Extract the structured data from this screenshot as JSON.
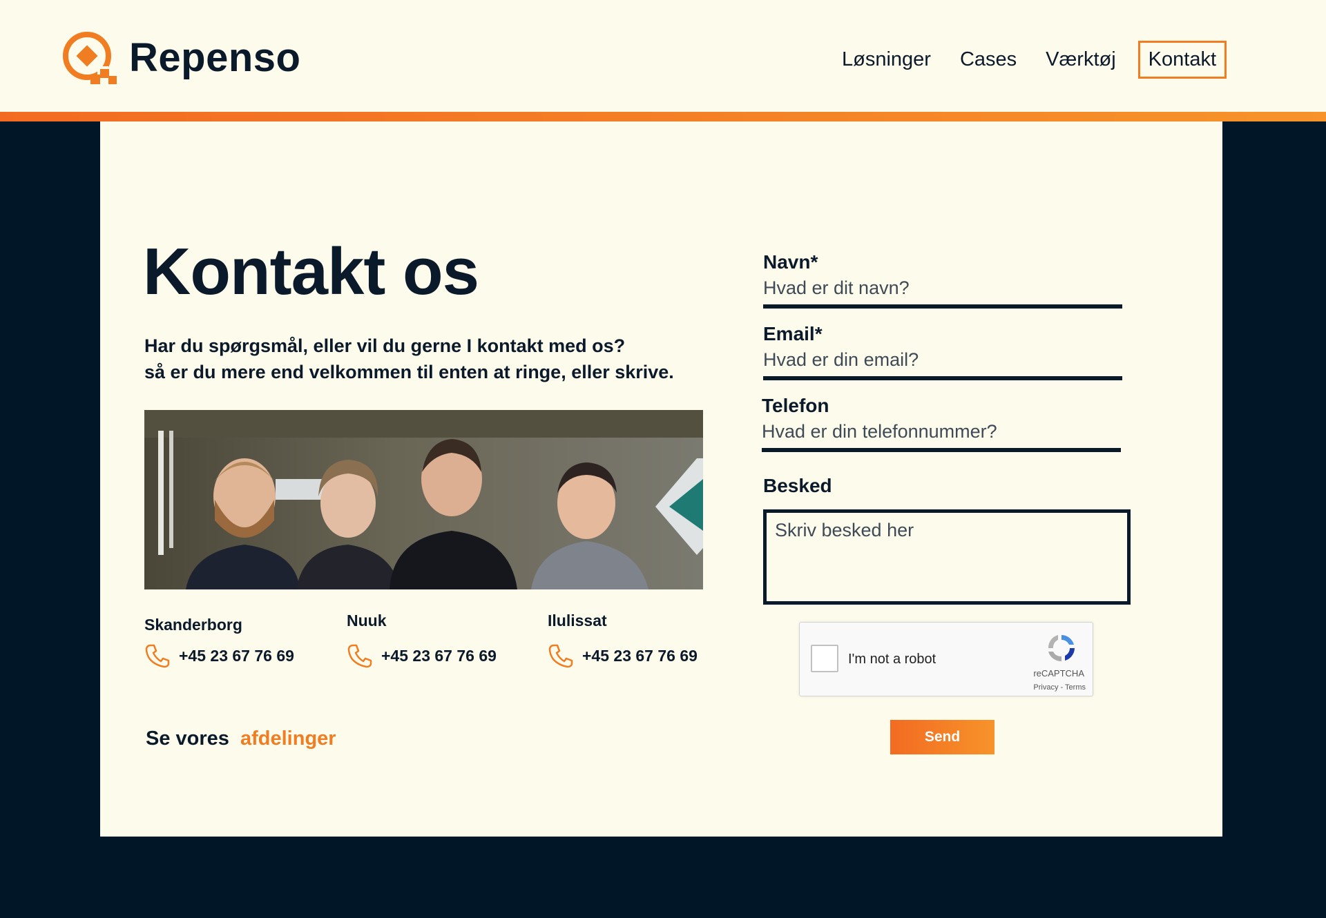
{
  "brand": {
    "name": "Repenso",
    "accent": "#f07d22",
    "dark": "#0b1a2a",
    "cream": "#fdfbeb"
  },
  "nav": {
    "items": [
      "Løsninger",
      "Cases",
      "Værktøj",
      "Kontakt"
    ],
    "active": "Kontakt"
  },
  "page": {
    "title": "Kontakt os",
    "intro_line1": "Har du spørgsmål, eller vil du gerne I kontakt med os?",
    "intro_line2": "så er du mere end velkommen til enten at ringe, eller skrive."
  },
  "offices": [
    {
      "name": "Skanderborg",
      "phone": "+45 23 67 76 69",
      "icon": "phone-icon"
    },
    {
      "name": "Nuuk",
      "phone": "+45 23 67 76 69",
      "icon": "phone-icon"
    },
    {
      "name": "Ilulissat",
      "phone": "+45 23 67 76 69",
      "icon": "phone-icon"
    }
  ],
  "departments": {
    "prefix": "Se vores",
    "link": "afdelinger"
  },
  "form": {
    "name_label": "Navn*",
    "name_placeholder": "Hvad er dit navn?",
    "email_label": "Email*",
    "email_placeholder": "Hvad er din email?",
    "phone_label": "Telefon",
    "phone_placeholder": "Hvad er din telefonnummer?",
    "message_label": "Besked",
    "message_placeholder": "Skriv besked her",
    "send_label": "Send"
  },
  "recaptcha": {
    "text": "I'm not a robot",
    "brand": "reCAPTCHA",
    "links": "Privacy - Terms"
  }
}
